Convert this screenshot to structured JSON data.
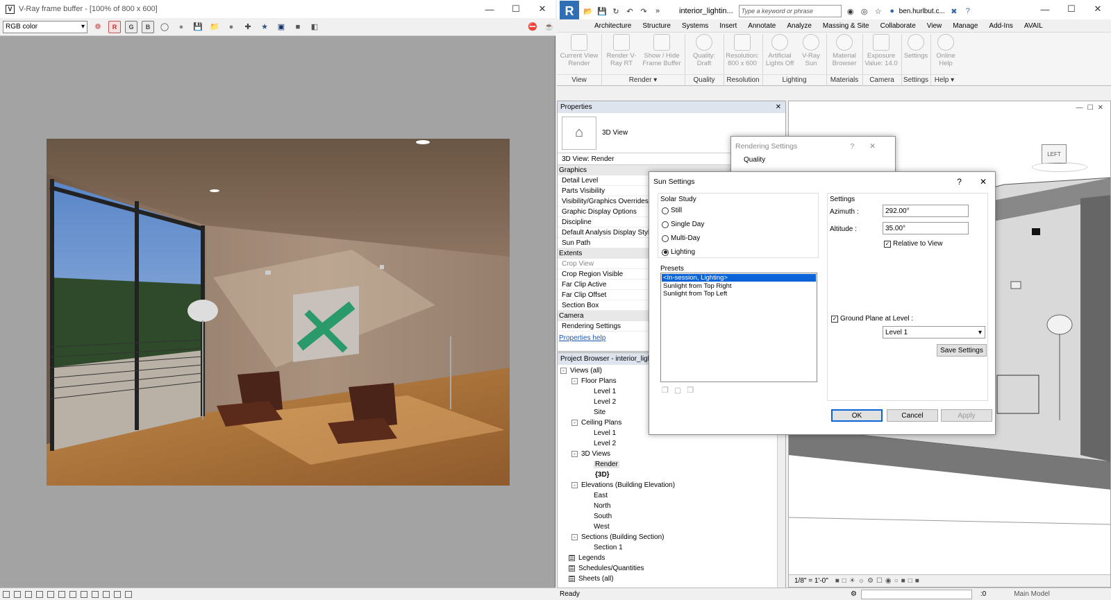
{
  "vray": {
    "title": "V-Ray frame buffer - [100% of 800 x 600]",
    "channel": "RGB color",
    "btn_r": "R",
    "btn_g": "G",
    "btn_b": "B"
  },
  "revit": {
    "doc_title": "interior_lightin...",
    "search_placeholder": "Type a keyword or phrase",
    "user": "ben.hurlbut.c...",
    "tabs": [
      "Architecture",
      "Structure",
      "Systems",
      "Insert",
      "Annotate",
      "Analyze",
      "Massing & Site",
      "Collaborate",
      "View",
      "Manage",
      "Add-Ins",
      "AVAIL"
    ],
    "ribbon": {
      "current_view_render": "Current View Render",
      "render_vray_rt": "Render V-Ray RT",
      "show_hide_fb": "Show / Hide Frame Buffer",
      "quality_draft": "Quality: Draft",
      "resolution": "Resolution: 800 x 600",
      "artificial_lights": "Artificial Lights Off",
      "vray_sun": "V-Ray Sun",
      "material_browser": "Material Browser",
      "exposure": "Exposure Value: 14.0",
      "settings": "Settings",
      "online_help": "Online Help",
      "panel_view": "View",
      "panel_render": "Render",
      "panel_quality": "Quality",
      "panel_resolution": "Resolution",
      "panel_lighting": "Lighting",
      "panel_materials": "Materials",
      "panel_camera": "Camera",
      "panel_settings": "Settings",
      "panel_help": "Help"
    },
    "properties": {
      "title": "Properties",
      "type": "3D View",
      "instance": "3D View: Render",
      "cat_graphics": "Graphics",
      "rows_graphics": [
        "Detail Level",
        "Parts Visibility",
        "Visibility/Graphics Overrides",
        "Graphic Display Options",
        "Discipline",
        "Default Analysis Display Style",
        "Sun Path"
      ],
      "cat_extents": "Extents",
      "rows_extents": [
        "Crop View",
        "Crop Region Visible",
        "Far Clip Active",
        "Far Clip Offset",
        "Section Box"
      ],
      "cat_camera": "Camera",
      "rows_camera": [
        "Rendering Settings"
      ],
      "help_link": "Properties help"
    },
    "browser": {
      "title": "Project Browser - interior_lighting",
      "views_all": "Views (all)",
      "floor_plans": "Floor Plans",
      "fp_level1": "Level 1",
      "fp_level2": "Level 2",
      "fp_site": "Site",
      "ceiling_plans": "Ceiling Plans",
      "cp_level1": "Level 1",
      "cp_level2": "Level 2",
      "views_3d": "3D Views",
      "v3d_render": "Render",
      "v3d_3d": "{3D}",
      "elevations": "Elevations (Building Elevation)",
      "el_east": "East",
      "el_north": "North",
      "el_south": "South",
      "el_west": "West",
      "sections": "Sections (Building Section)",
      "sec_1": "Section 1",
      "legends": "Legends",
      "schedules": "Schedules/Quantities",
      "sheets": "Sheets (all)"
    },
    "viewcube_label": "LEFT",
    "scale": "1/8\" = 1'-0\"",
    "status": "Ready",
    "status_zero": ":0",
    "main_model": "Main Model"
  },
  "rendering_settings": {
    "title": "Rendering Settings",
    "quality_label": "Quality"
  },
  "sun": {
    "title": "Sun Settings",
    "solar_study": "Solar Study",
    "still": "Still",
    "single_day": "Single Day",
    "multi_day": "Multi-Day",
    "lighting": "Lighting",
    "presets_label": "Presets",
    "presets": [
      "<In-session, Lighting>",
      "Sunlight from Top Right",
      "Sunlight from Top Left"
    ],
    "settings_label": "Settings",
    "azimuth_label": "Azimuth :",
    "azimuth": "292.00°",
    "altitude_label": "Altitude :",
    "altitude": "35.00°",
    "relative_to_view": "Relative to View",
    "ground_plane": "Ground Plane at Level :",
    "level": "Level 1",
    "save_settings": "Save Settings",
    "ok": "OK",
    "cancel": "Cancel",
    "apply": "Apply"
  }
}
